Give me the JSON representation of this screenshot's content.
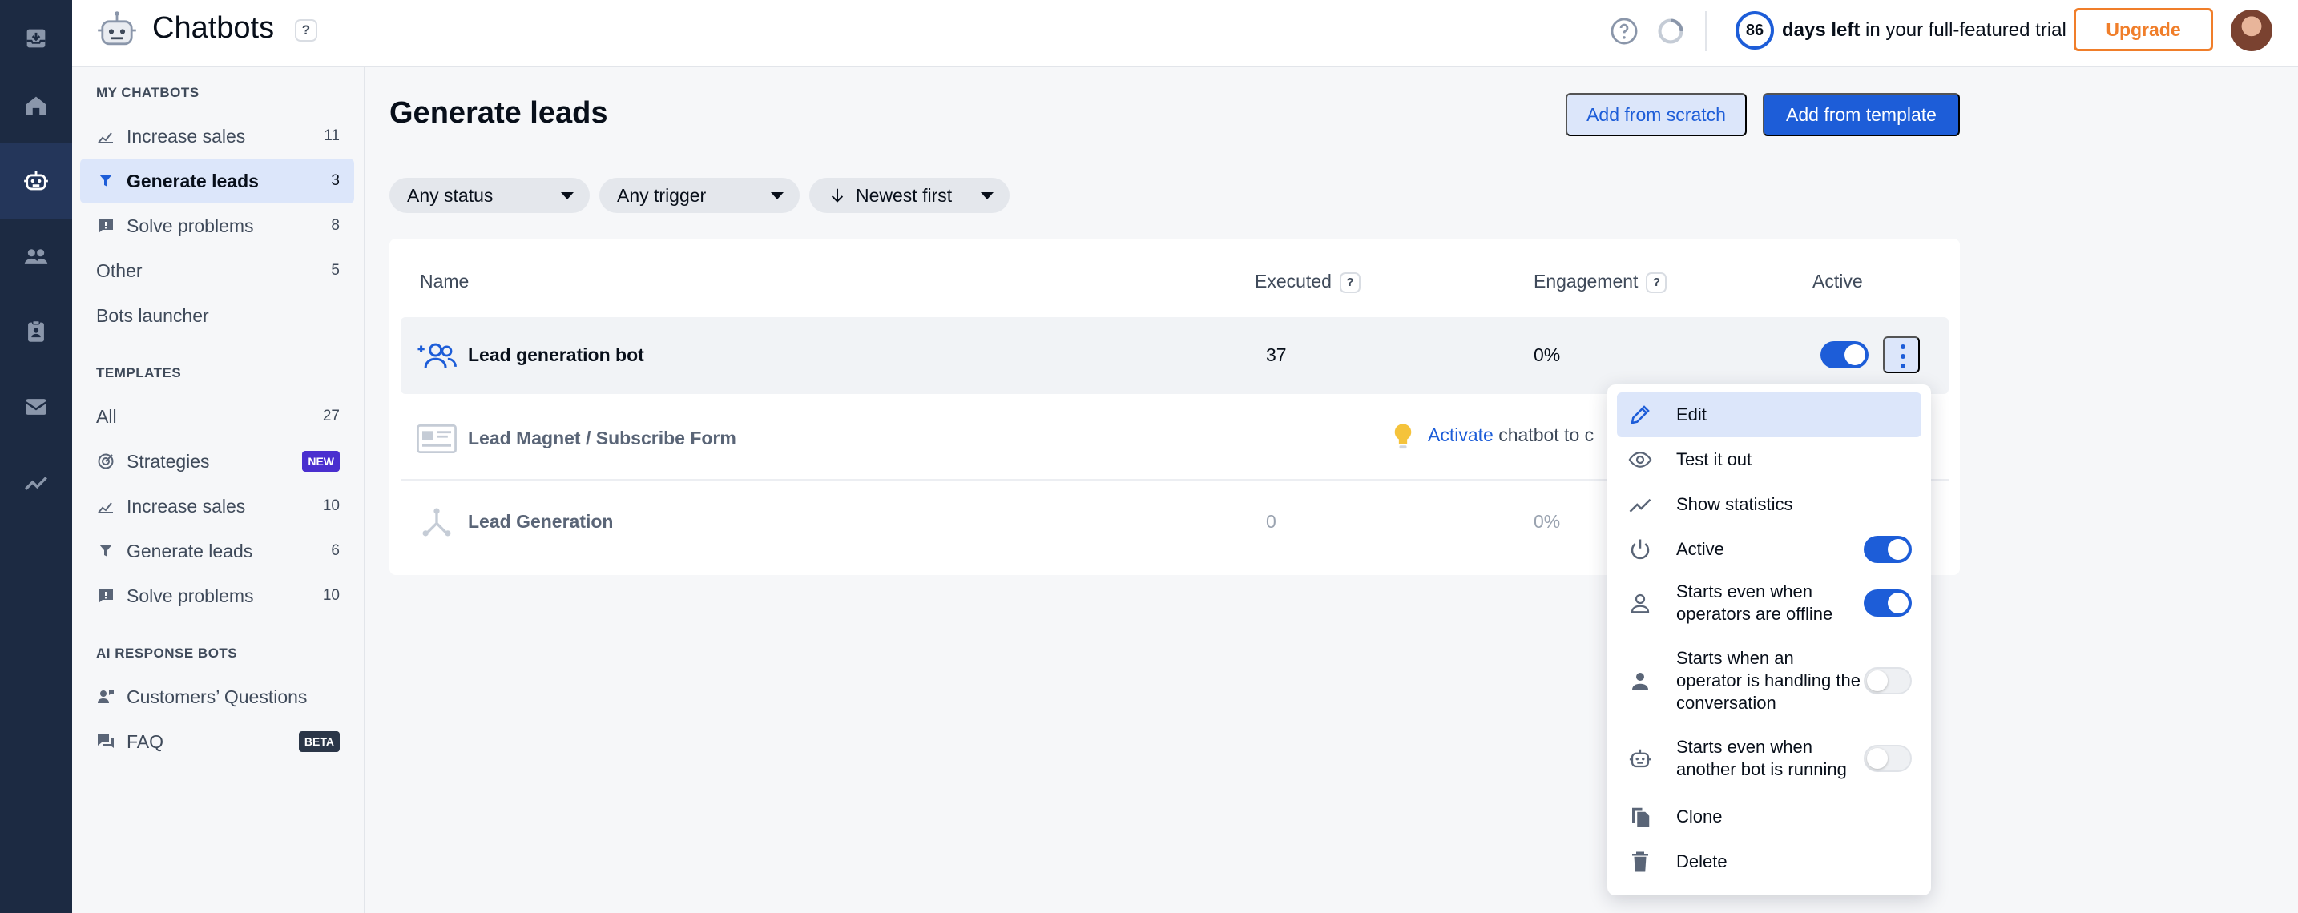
{
  "app": {
    "title": "Chatbots",
    "help": "?",
    "trial": {
      "days": "86",
      "days_label": "days left",
      "rest": " in your full-featured trial"
    },
    "upgrade_label": "Upgrade"
  },
  "rail": [
    "inbox-icon",
    "home-icon",
    "chatbot-icon",
    "contacts-icon",
    "tasks-icon",
    "mail-icon",
    "analytics-icon"
  ],
  "sidebar": {
    "my_chatbots_title": "MY CHATBOTS",
    "my_chatbots": [
      {
        "label": "Increase sales",
        "count": "11"
      },
      {
        "label": "Generate leads",
        "count": "3"
      },
      {
        "label": "Solve problems",
        "count": "8"
      },
      {
        "label": "Other",
        "count": "5"
      },
      {
        "label": "Bots launcher",
        "count": ""
      }
    ],
    "templates_title": "TEMPLATES",
    "templates": [
      {
        "label": "All",
        "count": "27"
      },
      {
        "label": "Strategies",
        "badge": "NEW"
      },
      {
        "label": "Increase sales",
        "count": "10"
      },
      {
        "label": "Generate leads",
        "count": "6"
      },
      {
        "label": "Solve problems",
        "count": "10"
      }
    ],
    "ai_title": "AI RESPONSE BOTS",
    "ai": [
      {
        "label": "Customers’ Questions"
      },
      {
        "label": "FAQ",
        "badge": "BETA"
      }
    ]
  },
  "main": {
    "title": "Generate leads",
    "add_scratch": "Add from scratch",
    "add_template": "Add from template",
    "filters": {
      "status": "Any status",
      "trigger": "Any trigger",
      "sort": "Newest first"
    },
    "columns": {
      "name": "Name",
      "executed": "Executed",
      "engagement": "Engagement",
      "active": "Active",
      "help": "?"
    },
    "rows": [
      {
        "name": "Lead generation bot",
        "executed": "37",
        "engagement": "0%",
        "active": true
      },
      {
        "name": "Lead Magnet / Subscribe Form",
        "activate_link": "Activate",
        "activate_rest": " chatbot to c"
      },
      {
        "name": "Lead Generation",
        "executed": "0",
        "engagement": "0%"
      }
    ]
  },
  "menu": {
    "items": [
      {
        "label": "Edit",
        "icon": "pencil-icon"
      },
      {
        "label": "Test it out",
        "icon": "eye-icon"
      },
      {
        "label": "Show statistics",
        "icon": "stats-icon"
      },
      {
        "label": "Active",
        "icon": "power-icon",
        "toggle": true
      },
      {
        "label": "Starts even when operators are offline",
        "icon": "person-outline-icon",
        "toggle": true
      },
      {
        "label": "Starts when an operator is handling the conversation",
        "icon": "person-icon",
        "toggle": false
      },
      {
        "label": "Starts even when another bot is running",
        "icon": "bot-icon",
        "toggle": false
      },
      {
        "label": "Clone",
        "icon": "copy-icon"
      },
      {
        "label": "Delete",
        "icon": "trash-icon"
      }
    ]
  },
  "colors": {
    "accent": "#1d5dd8",
    "rail": "#1c2a42",
    "upgrade": "#f07e2a",
    "online": "#2bc25a"
  }
}
